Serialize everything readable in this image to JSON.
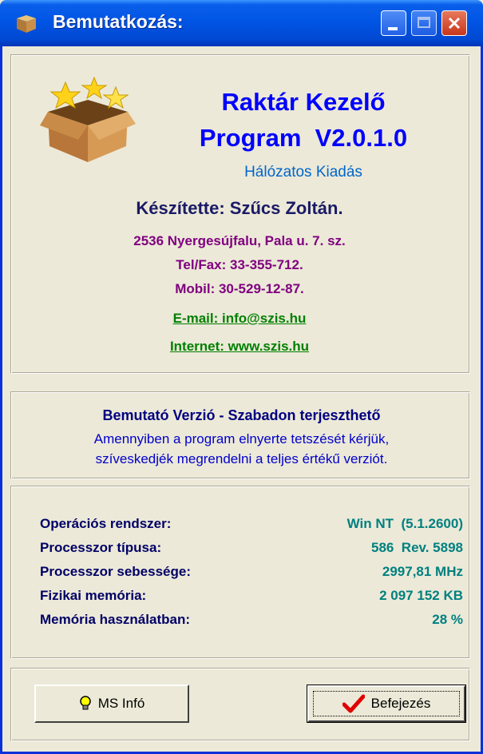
{
  "window": {
    "title": "Bemutatkozás:"
  },
  "about": {
    "app_name": "Raktár Kezelő",
    "version_line": "Program  V2.0.1.0",
    "edition": "Hálózatos Kiadás",
    "author": "Készítette: Szűcs Zoltán.",
    "address": "2536 Nyergesújfalu, Pala u. 7. sz.",
    "telfax": "Tel/Fax: 33-355-712.",
    "mobile": "Mobil: 30-529-12-87.",
    "email": "E-mail: info@szis.hu",
    "internet": "Internet: www.szis.hu"
  },
  "demo": {
    "title": "Bemutató Verzió - Szabadon terjeszthető",
    "line1": "Amennyiben a program elnyerte tetszését kérjük,",
    "line2": "szíveskedjék megrendelni a teljes értékű verziót."
  },
  "system_info": [
    {
      "label": "Operációs rendszer:",
      "value": "Win NT  (5.1.2600)"
    },
    {
      "label": "Processzor típusa:",
      "value": "586  Rev. 5898"
    },
    {
      "label": "Processzor sebessége:",
      "value": "2997,81 MHz"
    },
    {
      "label": "Fizikai memória:",
      "value": "2 097 152 KB"
    },
    {
      "label": "Memória használatban:",
      "value": "28 %"
    }
  ],
  "buttons": {
    "ms_info": "MS Infó",
    "finish": "Befejezés"
  },
  "icons": {
    "title": "box-icon",
    "ms_info": "lightbulb-icon",
    "finish": "checkmark-icon"
  },
  "colors": {
    "titlebar": "#0155e5",
    "app_title": "#0000ff",
    "address": "#800080",
    "link": "#008000",
    "value": "#008080"
  }
}
